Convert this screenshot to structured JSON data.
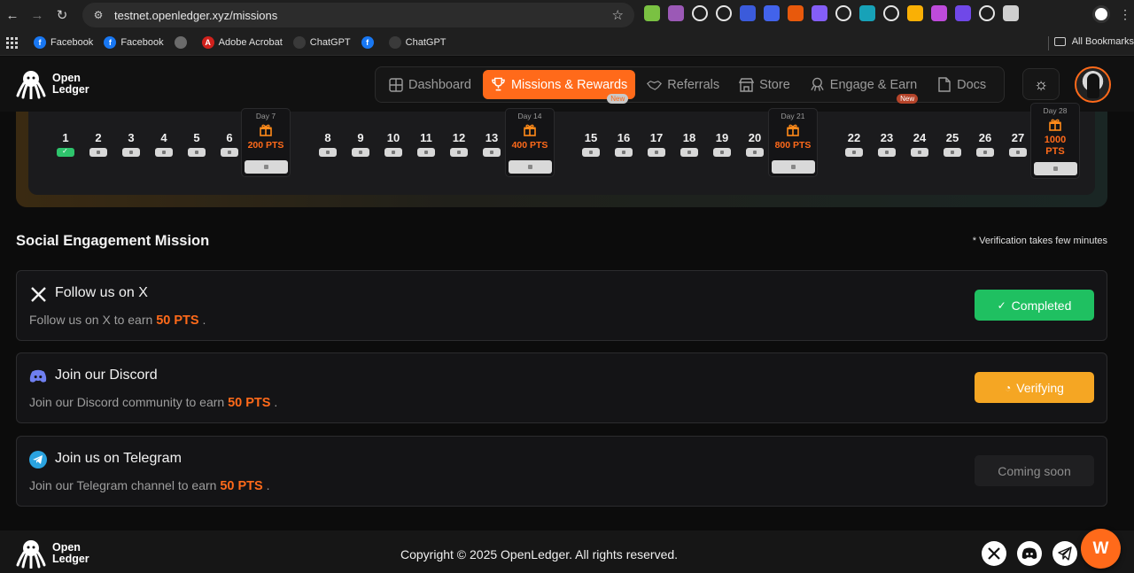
{
  "browser": {
    "url": "testnet.openledger.xyz/missions",
    "bookmarks": [
      {
        "label": "Facebook",
        "icon": "facebook-icon",
        "color": "#1877f2"
      },
      {
        "label": "Facebook",
        "icon": "facebook-icon",
        "color": "#1877f2"
      },
      {
        "label": "",
        "icon": "globe-icon",
        "color": "#6b6b6b"
      },
      {
        "label": "Adobe Acrobat",
        "icon": "adobe-acrobat-icon",
        "color": "#d0211c"
      },
      {
        "label": "ChatGPT",
        "icon": "chatgpt-icon",
        "color": "#3a3a3a"
      },
      {
        "label": "",
        "icon": "facebook-icon",
        "color": "#1877f2"
      },
      {
        "label": "ChatGPT",
        "icon": "chatgpt-icon",
        "color": "#3a3a3a"
      }
    ],
    "all_bookmarks": "All Bookmarks",
    "extension_colors": [
      "#7ac142",
      "#9b59b6",
      "#ffffff",
      "#ffffff",
      "#3b5bdb",
      "#4263eb",
      "#e8590c",
      "#845ef7",
      "#ffffff",
      "#17a2b8",
      "#ffffff",
      "#fab005",
      "#be4bdb",
      "#7048e8",
      "#ffffff",
      "#cfcfcf"
    ]
  },
  "header": {
    "logo_line1": "Open",
    "logo_line2": "Ledger",
    "nav": [
      {
        "label": "Dashboard",
        "icon": "dashboard-icon",
        "active": false
      },
      {
        "label": "Missions & Rewards",
        "icon": "trophy-icon",
        "active": true,
        "badge": "New"
      },
      {
        "label": "Referrals",
        "icon": "handshake-icon",
        "active": false
      },
      {
        "label": "Store",
        "icon": "store-icon",
        "active": false
      },
      {
        "label": "Engage & Earn",
        "icon": "octopus-icon",
        "active": false,
        "badge": "New"
      },
      {
        "label": "Docs",
        "icon": "document-icon",
        "active": false
      }
    ],
    "theme_icon": "sun-icon"
  },
  "streak": {
    "days": [
      "1",
      "2",
      "3",
      "4",
      "5",
      "6",
      "8",
      "9",
      "10",
      "11",
      "12",
      "13",
      "15",
      "16",
      "17",
      "18",
      "19",
      "20",
      "22",
      "23",
      "24",
      "25",
      "26",
      "27"
    ],
    "completed_days": [
      "1"
    ],
    "bonus": [
      {
        "label": "Day 7",
        "points": "200 PTS"
      },
      {
        "label": "Day 14",
        "points": "400 PTS"
      },
      {
        "label": "Day 21",
        "points": "800 PTS"
      },
      {
        "label": "Day 28",
        "points": "1000 PTS"
      }
    ]
  },
  "social": {
    "title": "Social Engagement Mission",
    "note": "* Verification takes few minutes",
    "missions": [
      {
        "title": "Follow us on X",
        "desc_prefix": "Follow us on X to earn",
        "points": "50 PTS",
        "desc_suffix": ".",
        "button": "Completed",
        "status": "completed",
        "icon": "x-logo-icon"
      },
      {
        "title": "Join our Discord",
        "desc_prefix": "Join our Discord community to earn",
        "points": "50 PTS",
        "desc_suffix": ".",
        "button": "Verifying",
        "status": "verifying",
        "icon": "discord-icon"
      },
      {
        "title": "Join us on Telegram",
        "desc_prefix": "Join our Telegram channel to earn",
        "points": "50 PTS",
        "desc_suffix": ".",
        "button": "Coming soon",
        "status": "coming-soon",
        "icon": "telegram-icon"
      }
    ]
  },
  "footer": {
    "logo_line1": "Open",
    "logo_line2": "Ledger",
    "copyright": "Copyright © 2025 OpenLedger. All rights reserved.",
    "fab_label": "W"
  },
  "colors": {
    "accent": "#ff6a1a",
    "completed": "#1fc061",
    "verifying": "#f5a623"
  }
}
